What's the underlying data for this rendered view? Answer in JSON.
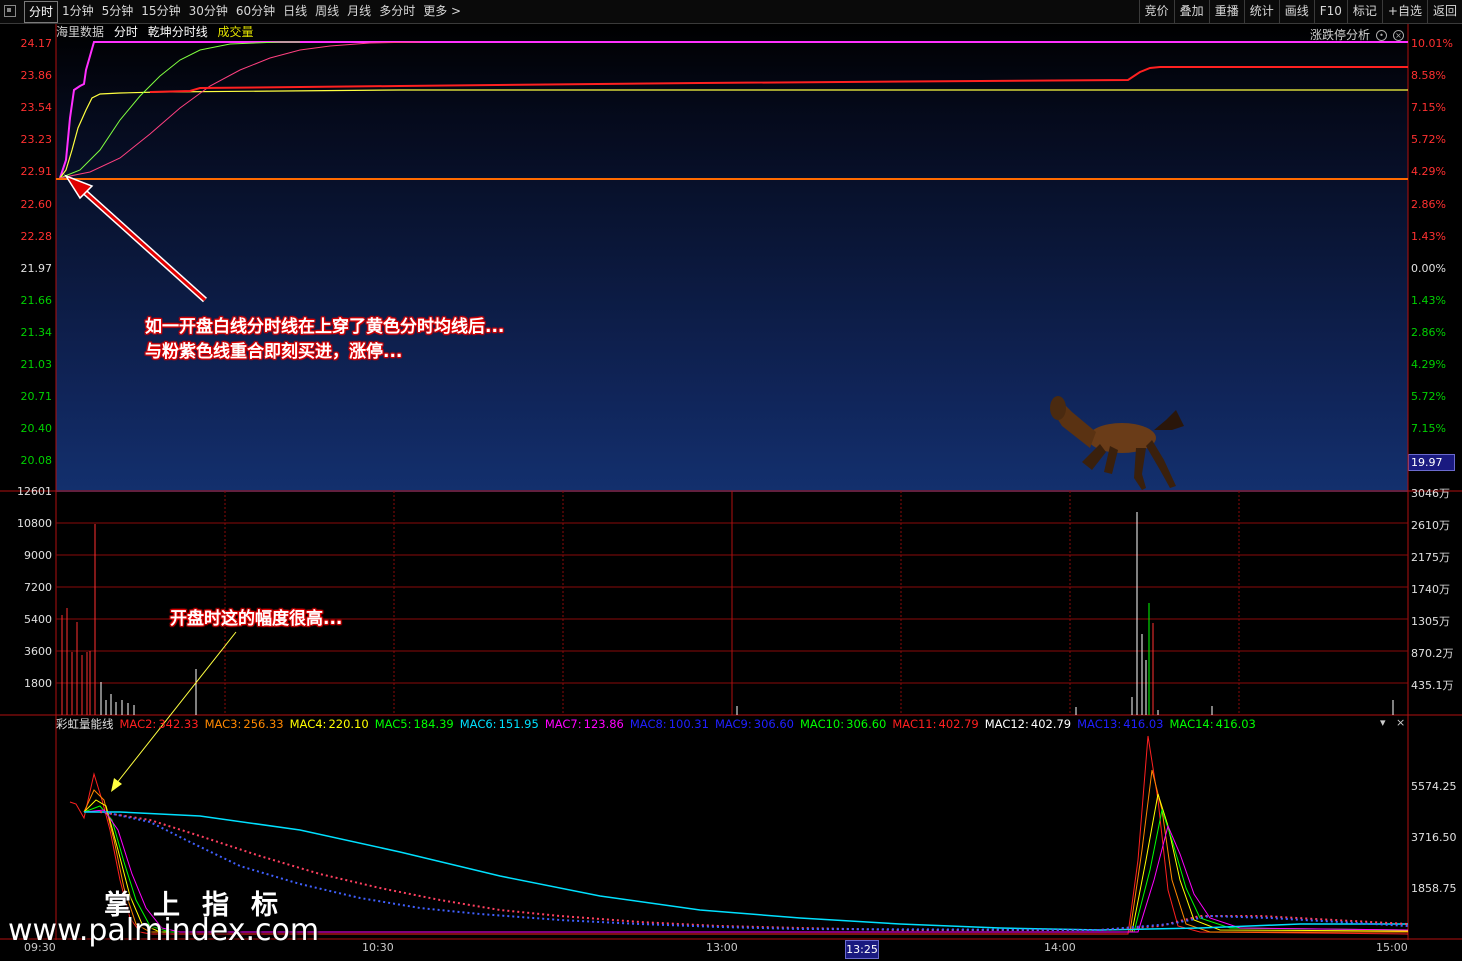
{
  "toolbar": {
    "periods": [
      "分时",
      "1分钟",
      "5分钟",
      "15分钟",
      "30分钟",
      "60分钟",
      "日线",
      "周线",
      "月线",
      "多分时",
      "更多 >"
    ],
    "tools": [
      "竞价",
      "叠加",
      "重播",
      "统计",
      "画线",
      "F10",
      "标记",
      "+自选",
      "返回"
    ]
  },
  "price_panel": {
    "source": "海里数据",
    "mode": "分时",
    "indicator": "乾坤分时线",
    "volume_label": "成交量",
    "zd_button": "涨跌停分析",
    "price_ticks": [
      "24.17",
      "23.86",
      "23.54",
      "23.23",
      "22.91",
      "22.60",
      "22.28",
      "21.97",
      "21.66",
      "21.34",
      "21.03",
      "20.71",
      "20.40",
      "20.08"
    ],
    "pct_ticks": [
      "10.01%",
      "8.58%",
      "7.15%",
      "5.72%",
      "4.29%",
      "2.86%",
      "1.43%",
      "0.00%",
      "1.43%",
      "2.86%",
      "4.29%",
      "5.72%",
      "7.15%"
    ],
    "current_price_tag": "19.97",
    "annotation_line1": "如一开盘白线分时线在上穿了黄色分时均线后...",
    "annotation_line2": "与粉紫色线重合即刻买进，涨停..."
  },
  "volume_panel": {
    "left_ticks": [
      "12601",
      "10800",
      "9000",
      "7200",
      "5400",
      "3600",
      "1800"
    ],
    "right_ticks": [
      "3046万",
      "2610万",
      "2175万",
      "1740万",
      "1305万",
      "870.2万",
      "435.1万"
    ],
    "annotation": "开盘时这的幅度很高..."
  },
  "indicator_panel": {
    "name": "彩虹量能线",
    "values": [
      {
        "label": "MAC2:",
        "value": "342.33",
        "color": "#ff2020"
      },
      {
        "label": "MAC3:",
        "value": "256.33",
        "color": "#ff8800"
      },
      {
        "label": "MAC4:",
        "value": "220.10",
        "color": "#ffff00"
      },
      {
        "label": "MAC5:",
        "value": "184.39",
        "color": "#00ff00"
      },
      {
        "label": "MAC6:",
        "value": "151.95",
        "color": "#00e0ff"
      },
      {
        "label": "MAC7:",
        "value": "123.86",
        "color": "#ff00ff"
      },
      {
        "label": "MAC8:",
        "value": "100.31",
        "color": "#2020ff"
      },
      {
        "label": "MAC9:",
        "value": "306.60",
        "color": "#2020ff"
      },
      {
        "label": "MAC10:",
        "value": "306.60",
        "color": "#00ff00"
      },
      {
        "label": "MAC11:",
        "value": "402.79",
        "color": "#ff2020"
      },
      {
        "label": "MAC12:",
        "value": "402.79",
        "color": "#ffffff"
      },
      {
        "label": "MAC13:",
        "value": "416.03",
        "color": "#2020ff"
      },
      {
        "label": "MAC14:",
        "value": "416.03",
        "color": "#00ff00"
      }
    ],
    "right_ticks": [
      "5574.25",
      "3716.50",
      "1858.75"
    ]
  },
  "time_axis": {
    "labels": [
      "09:30",
      "10:30",
      "13:00",
      "14:00",
      "15:00"
    ],
    "cursor": "13:25"
  },
  "watermark": {
    "cn": "掌上指标",
    "url": "www.palmindex.com"
  },
  "colors": {
    "up": "#ff3030",
    "down": "#00c000",
    "grid": "#b01010",
    "price_line": "#ff2020",
    "avg_line": "#ffff40",
    "qiankun_line": "#ff30ff",
    "green_line": "#80ff40",
    "annotation_bg": "#e00000"
  }
}
